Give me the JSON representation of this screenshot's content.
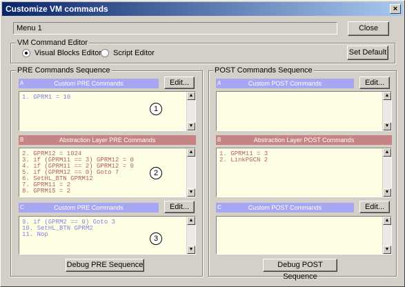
{
  "window": {
    "title": "Customize VM commands",
    "close_glyph": "×"
  },
  "menu_field": {
    "value": "Menu 1"
  },
  "buttons": {
    "close": "Close",
    "set_default": "Set Default",
    "edit": "Edit...",
    "debug_pre": "Debug PRE Sequence",
    "debug_post": "Debug POST Sequence"
  },
  "editor_group": {
    "title": "VM Command Editor",
    "options": [
      {
        "label": "Visual Blocks Editor",
        "selected": true
      },
      {
        "label": "Script Editor",
        "selected": false
      }
    ]
  },
  "pre": {
    "title": "PRE Commands Sequence",
    "sections": [
      {
        "tag": "A",
        "header": "Custom PRE Commands",
        "style": "blue",
        "lines": [
          "1. GPRM1 = 10"
        ],
        "marker": "1"
      },
      {
        "tag": "B",
        "header": "Abstraction Layer PRE Commands",
        "style": "red",
        "lines": [
          "2. GPRM12 = 1024",
          "3. if (GPRM11 == 3) GPRM12 = 0",
          "4. if (GPRM11 == 2) GPRM12 = 0",
          "5. if (GPRM12 == 0) Goto 7",
          "6. SetHL_BTN GPRM12",
          "7. GPRM11 = 2",
          "8. GPRM15 = 2"
        ],
        "marker": "2"
      },
      {
        "tag": "C",
        "header": "Custom PRE Commands",
        "style": "blue",
        "lines": [
          "9. if (GPRM2 == 0) Goto 3",
          "10. SetHL_BTN GPRM2",
          "11. Nop"
        ],
        "marker": "3"
      }
    ]
  },
  "post": {
    "title": "POST Commands Sequence",
    "sections": [
      {
        "tag": "A",
        "header": "Custom POST Commands",
        "style": "blue",
        "lines": []
      },
      {
        "tag": "B",
        "header": "Abstraction Layer POST Commands",
        "style": "red",
        "lines": [
          "1. GPRM11 = 3",
          "2. LinkPGCN 2"
        ]
      },
      {
        "tag": "C",
        "header": "Custom POST Commands",
        "style": "blue",
        "lines": []
      }
    ]
  },
  "colors": {
    "title_start": "#0a246a",
    "blue_bar": "#a7a6f2",
    "red_bar": "#c78484",
    "code_bg": "#ffffe6"
  },
  "icons": {
    "scroll_up": "▲",
    "scroll_down": "▼"
  }
}
